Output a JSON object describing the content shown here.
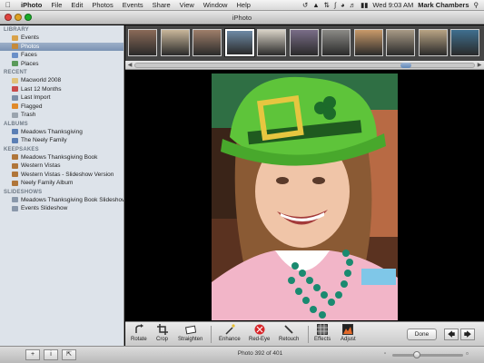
{
  "menubar": {
    "items": [
      "iPhoto",
      "File",
      "Edit",
      "Photos",
      "Events",
      "Share",
      "View",
      "Window",
      "Help"
    ],
    "clock": "Wed 9:03 AM",
    "user": "Mark Chambers"
  },
  "window": {
    "title": "iPhoto"
  },
  "sidebar": {
    "sections": [
      {
        "header": "LIBRARY",
        "items": [
          {
            "label": "Events",
            "icon": "events-icon",
            "color": "#d9a24a"
          },
          {
            "label": "Photos",
            "icon": "photos-icon",
            "color": "#c58a3a",
            "selected": true
          },
          {
            "label": "Faces",
            "icon": "faces-icon",
            "color": "#6a8fc8"
          },
          {
            "label": "Places",
            "icon": "places-icon",
            "color": "#5a9a5a"
          }
        ]
      },
      {
        "header": "RECENT",
        "items": [
          {
            "label": "Macworld 2008",
            "icon": "event-icon",
            "color": "#e0c27a"
          },
          {
            "label": "Last 12 Months",
            "icon": "calendar-icon",
            "color": "#c94b4b"
          },
          {
            "label": "Last Import",
            "icon": "import-icon",
            "color": "#7d8fa8"
          },
          {
            "label": "Flagged",
            "icon": "flag-icon",
            "color": "#e08a2a"
          },
          {
            "label": "Trash",
            "icon": "trash-icon",
            "color": "#9aa4ae"
          }
        ]
      },
      {
        "header": "ALBUMS",
        "items": [
          {
            "label": "Meadows Thanksgiving",
            "icon": "album-icon",
            "color": "#5b7fb5"
          },
          {
            "label": "The Neely Family",
            "icon": "album-icon",
            "color": "#5b7fb5"
          }
        ]
      },
      {
        "header": "KEEPSAKES",
        "items": [
          {
            "label": "Meadows Thanksgiving Book",
            "icon": "book-icon",
            "color": "#b0763a"
          },
          {
            "label": "Western Vistas",
            "icon": "book-icon",
            "color": "#b0763a"
          },
          {
            "label": "Western Vistas - Slideshow Version",
            "icon": "book-icon",
            "color": "#b0763a"
          },
          {
            "label": "Neely Family Album",
            "icon": "book-icon",
            "color": "#b0763a"
          }
        ]
      },
      {
        "header": "SLIDESHOWS",
        "items": [
          {
            "label": "Meadows Thanksgiving Book Slideshow",
            "icon": "slideshow-icon",
            "color": "#8a98aa"
          },
          {
            "label": "Events Slideshow",
            "icon": "slideshow-icon",
            "color": "#8a98aa"
          }
        ]
      }
    ]
  },
  "filmstrip": {
    "thumbs": [
      {
        "color": "#8a6a58"
      },
      {
        "color": "#c9b79a"
      },
      {
        "color": "#9f7e6a"
      },
      {
        "color": "#6e8aa6",
        "selected": true
      },
      {
        "color": "#d8d2c6"
      },
      {
        "color": "#7a6d88"
      },
      {
        "color": "#8b8a86"
      },
      {
        "color": "#c99a6a"
      },
      {
        "color": "#a89a86"
      },
      {
        "color": "#b9a484"
      },
      {
        "color": "#3f6f8f"
      }
    ],
    "scroll_position": 0.78
  },
  "toolbar": {
    "tools": [
      {
        "label": "Rotate",
        "icon": "rotate-icon"
      },
      {
        "label": "Crop",
        "icon": "crop-icon"
      },
      {
        "label": "Straighten",
        "icon": "straighten-icon"
      },
      {
        "label": "Enhance",
        "icon": "enhance-wand-icon"
      },
      {
        "label": "Red-Eye",
        "icon": "red-eye-icon"
      },
      {
        "label": "Retouch",
        "icon": "retouch-brush-icon"
      },
      {
        "label": "Effects",
        "icon": "effects-grid-icon"
      },
      {
        "label": "Adjust",
        "icon": "adjust-histogram-icon"
      }
    ],
    "done_label": "Done",
    "prev_icon": "arrow-left-icon",
    "next_icon": "arrow-right-icon"
  },
  "bottombar": {
    "status": "Photo 392 of 401",
    "buttons": [
      "add-icon",
      "info-icon",
      "fullscreen-icon"
    ],
    "zoom_level": 0.35
  },
  "colors": {
    "sidebar_bg": "#dde3ea",
    "selection": "#7a92b3",
    "photo_hat": "#5ec43a",
    "photo_buckle": "#e6c640"
  }
}
